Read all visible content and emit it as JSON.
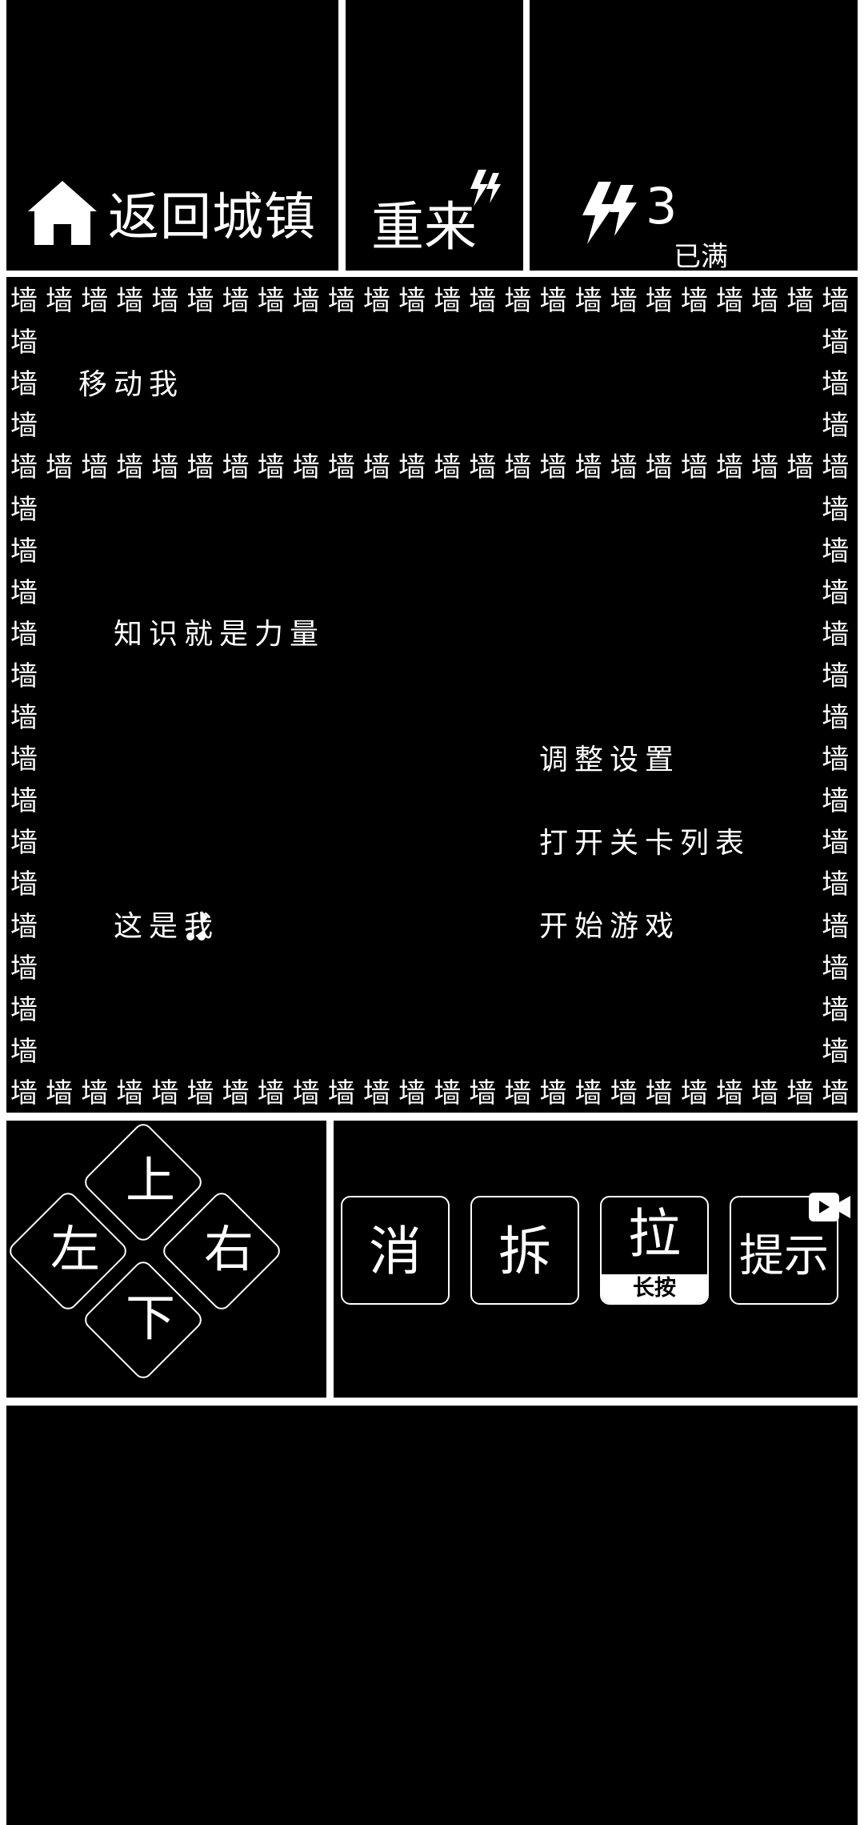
{
  "header": {
    "home_label": "返回城镇",
    "retry_label": "重来",
    "energy_count": "3",
    "energy_status": "已满"
  },
  "board": {
    "wall_char": "墙",
    "texts": {
      "move_me": "移动我",
      "knowledge": "知识就是力量",
      "settings": "调整设置",
      "level_list": "打开关卡列表",
      "start_game": "开始游戏",
      "this_is_me": "这是我"
    }
  },
  "dpad": {
    "up": "上",
    "down": "下",
    "left": "左",
    "right": "右"
  },
  "tools": {
    "eliminate": "消",
    "dismantle": "拆",
    "pull": "拉",
    "pull_hint": "长按",
    "hint": "提示"
  },
  "colors": {
    "background": "#000000",
    "foreground": "#ffffff"
  },
  "icons": [
    "house-icon",
    "lightning-icon",
    "video-icon"
  ]
}
